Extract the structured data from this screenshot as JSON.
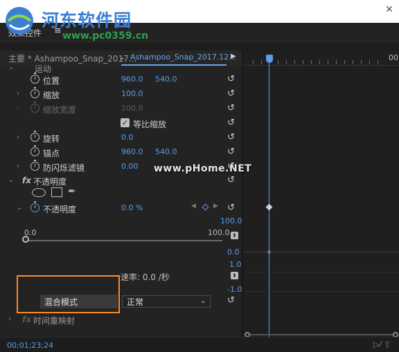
{
  "watermark": {
    "name": "河东软件园",
    "url": "www.pc0359.cn"
  },
  "watermark2": "www.pHome.NET",
  "panel": {
    "title": "效果控件",
    "menu_icon": "≡"
  },
  "clip_bar": {
    "master": "主要 * Ashampoo_Snap_2017...",
    "dropdown": "⌄",
    "sequence": "Ashampoo_Snap_2017.12...",
    "play": "▶"
  },
  "timeline": {
    "ruler_label": "00"
  },
  "properties": {
    "motion_label": "运动",
    "position": {
      "label": "位置",
      "x": "960.0",
      "y": "540.0"
    },
    "scale": {
      "label": "缩放",
      "value": "100.0"
    },
    "scale_width": {
      "label": "缩放宽度",
      "value": "100.0"
    },
    "uniform_scale": {
      "label": "等比缩放",
      "checked": true
    },
    "rotation": {
      "label": "旋转",
      "value": "0.0"
    },
    "anchor": {
      "label": "锚点",
      "x": "960.0",
      "y": "540.0"
    },
    "anti_flicker": {
      "label": "防闪烁滤镜",
      "value": "0.00"
    },
    "opacity_section": {
      "fx": "fx",
      "label": "不透明度"
    },
    "opacity": {
      "label": "不透明度",
      "value": "0.0 %"
    },
    "slider": {
      "min_label": "0.0",
      "max_label": "100.0",
      "top_value": "100.0",
      "bottom_value": "0.0"
    },
    "speed": {
      "max": "1.0",
      "label": "速率: 0.0 /秒",
      "min": "-1.0"
    },
    "blend": {
      "label": "混合模式",
      "value": "正常"
    },
    "time_remap": {
      "fx": "fx",
      "label": "时间重映射"
    }
  },
  "status": {
    "timecode": "00;01;23;24",
    "icons": "▷⁄  ⇪"
  },
  "colors": {
    "accent": "#5a9ee8",
    "highlight": "#ff8a2a",
    "bg": "#232323"
  }
}
